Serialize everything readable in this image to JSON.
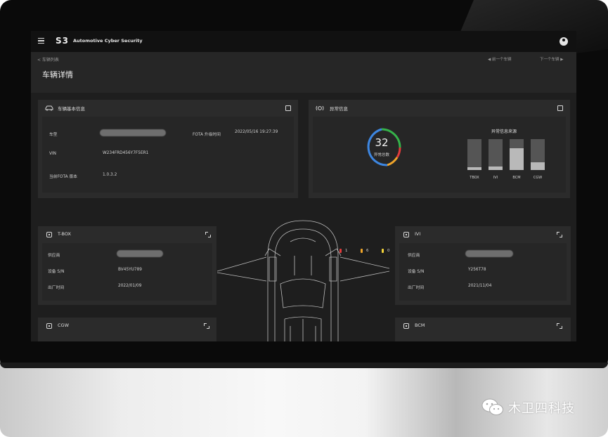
{
  "app": {
    "logo": "S3",
    "brand": "Automotive Cyber Security",
    "menu_icon": "hamburger-menu-icon",
    "user_icon": "user-avatar-icon"
  },
  "header": {
    "back_link": "< 车辆列表",
    "title": "车辆详情",
    "prev_link": "◀  前一个车辆",
    "next_link": "下一个车辆  ▶"
  },
  "vehicle_info": {
    "title": "车辆基本信息",
    "model_label": "车型",
    "fota_time_label": "FOTA 升级时间",
    "fota_time_value": "2022/05/16 19:27:39",
    "vin_label": "VIN",
    "vin_value": "W234FRD456Y7F5ER1",
    "fota_version_label": "当前FOTA 版本",
    "fota_version_value": "1.0.3.2"
  },
  "anomaly": {
    "title": "异常信息",
    "total_value": "32",
    "total_label": "异常总数",
    "source_title": "异常信息来源",
    "legend": [
      {
        "value": "1",
        "color": "#e33b3b"
      },
      {
        "value": "6",
        "color": "#f0a52a"
      },
      {
        "value": "0",
        "color": "#f2d23a"
      },
      {
        "value": "15",
        "color": "#3d86e0"
      },
      {
        "value": "10",
        "color": "#36b24a"
      }
    ],
    "source_bars": [
      {
        "label": "TBOX",
        "level": 0.1
      },
      {
        "label": "IVI",
        "level": 0.12
      },
      {
        "label": "BCM",
        "level": 0.7
      },
      {
        "label": "CGW",
        "level": 0.24
      }
    ]
  },
  "tbox": {
    "title": "T-BOX",
    "supplier_label": "供应商",
    "serial_label": "设备 S/N",
    "serial_value": "BV45YU789",
    "date_label": "出厂时间",
    "date_value": "2022/01/09"
  },
  "ivi": {
    "title": "IVI",
    "supplier_label": "供应商",
    "serial_label": "设备 S/N",
    "serial_value": "Y256T78",
    "date_label": "出厂时间",
    "date_value": "2021/11/04"
  },
  "cgw": {
    "title": "CGW"
  },
  "bcm": {
    "title": "BCM"
  },
  "watermark": {
    "text": "木卫四科技"
  }
}
